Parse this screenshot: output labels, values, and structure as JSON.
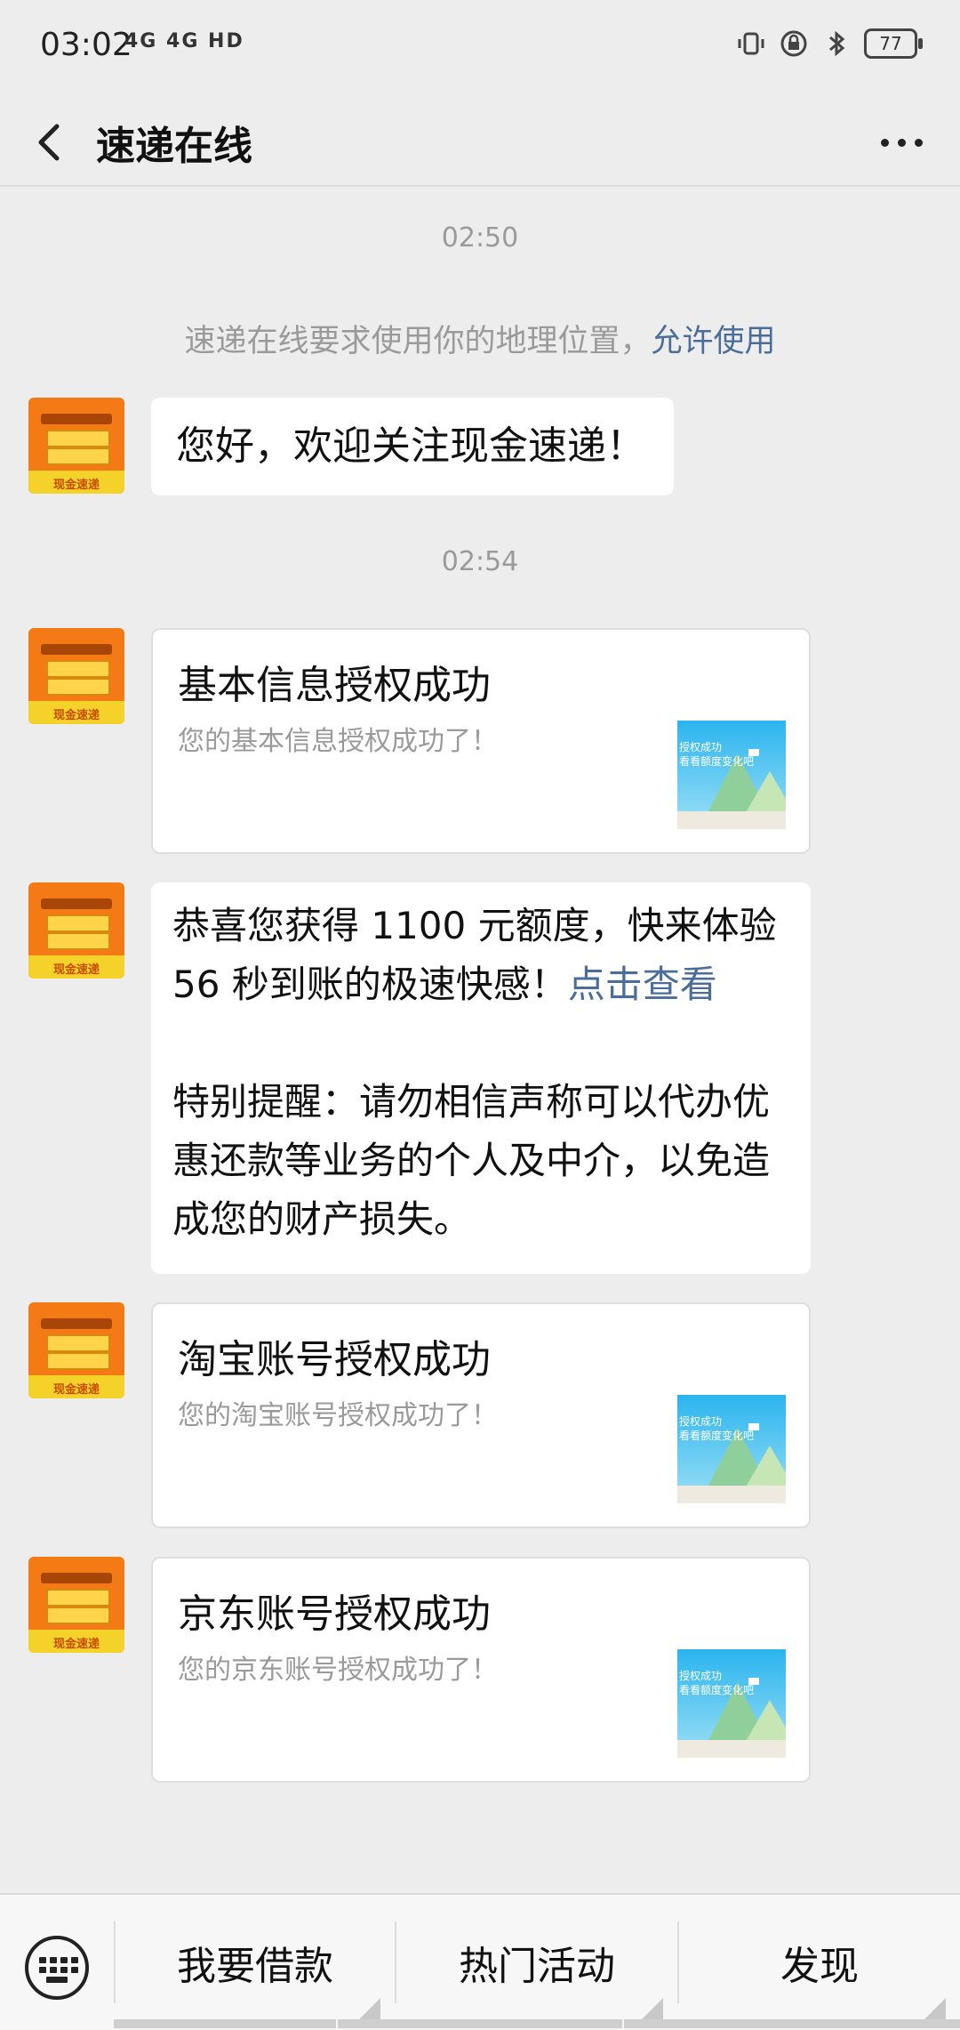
{
  "status_bar": {
    "time": "03:02",
    "network": "4G 4G HD",
    "battery": "77"
  },
  "header": {
    "title": "速递在线"
  },
  "chat": {
    "timestamps": [
      "02:50",
      "02:54"
    ],
    "system_message": {
      "text": "速递在线要求使用你的地理位置，",
      "link": "允许使用"
    },
    "avatar_label": "现金速递",
    "welcome": "您好，欢迎关注现金速递！",
    "cards": [
      {
        "title": "基本信息授权成功",
        "subtitle": "您的基本信息授权成功了！",
        "thumb_text_1": "授权成功",
        "thumb_text_2": "看看额度变化吧"
      },
      {
        "title": "淘宝账号授权成功",
        "subtitle": "您的淘宝账号授权成功了！",
        "thumb_text_1": "授权成功",
        "thumb_text_2": "看看额度变化吧"
      },
      {
        "title": "京东账号授权成功",
        "subtitle": "您的京东账号授权成功了！",
        "thumb_text_1": "授权成功",
        "thumb_text_2": "看看额度变化吧"
      }
    ],
    "promo": {
      "line1": "恭喜您获得 1100 元额度，快来体验",
      "line2": "56 秒到账的极速快感！",
      "link": "点击查看",
      "reminder": "特别提醒：请勿相信声称可以代办优惠还款等业务的个人及中介，以免造成您的财产损失。"
    }
  },
  "bottom_menu": {
    "items": [
      "我要借款",
      "热门活动",
      "发现"
    ]
  }
}
